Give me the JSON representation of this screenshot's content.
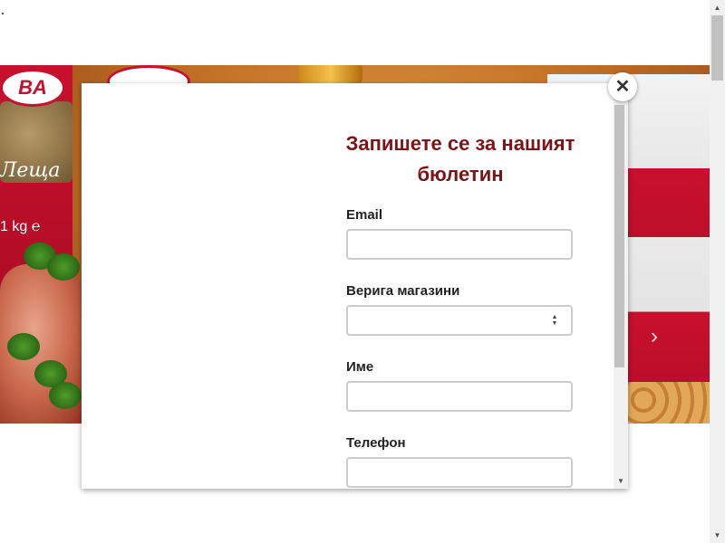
{
  "newsletter": {
    "title": "Запишете се за нашият бюлетин",
    "fields": {
      "email": {
        "label": "Email",
        "value": "",
        "placeholder": ""
      },
      "chain": {
        "label": "Верига магазини",
        "selected": ""
      },
      "name": {
        "label": "Име",
        "value": "",
        "placeholder": ""
      },
      "phone": {
        "label": "Телефон",
        "value": "",
        "placeholder": ""
      }
    },
    "close_glyph": "✕"
  },
  "banner": {
    "brand_text": "BA",
    "left_bag_label": "Леща",
    "left_bag_weight": "1 kg ℮",
    "next_glyph": "›"
  },
  "colors": {
    "title": "#7a1416",
    "brand_red": "#c8102e",
    "input_border": "#cccccc"
  },
  "icons": {
    "close": "close-icon",
    "select_arrows": "select-arrows-icon",
    "slider_next": "chevron-right-icon"
  }
}
